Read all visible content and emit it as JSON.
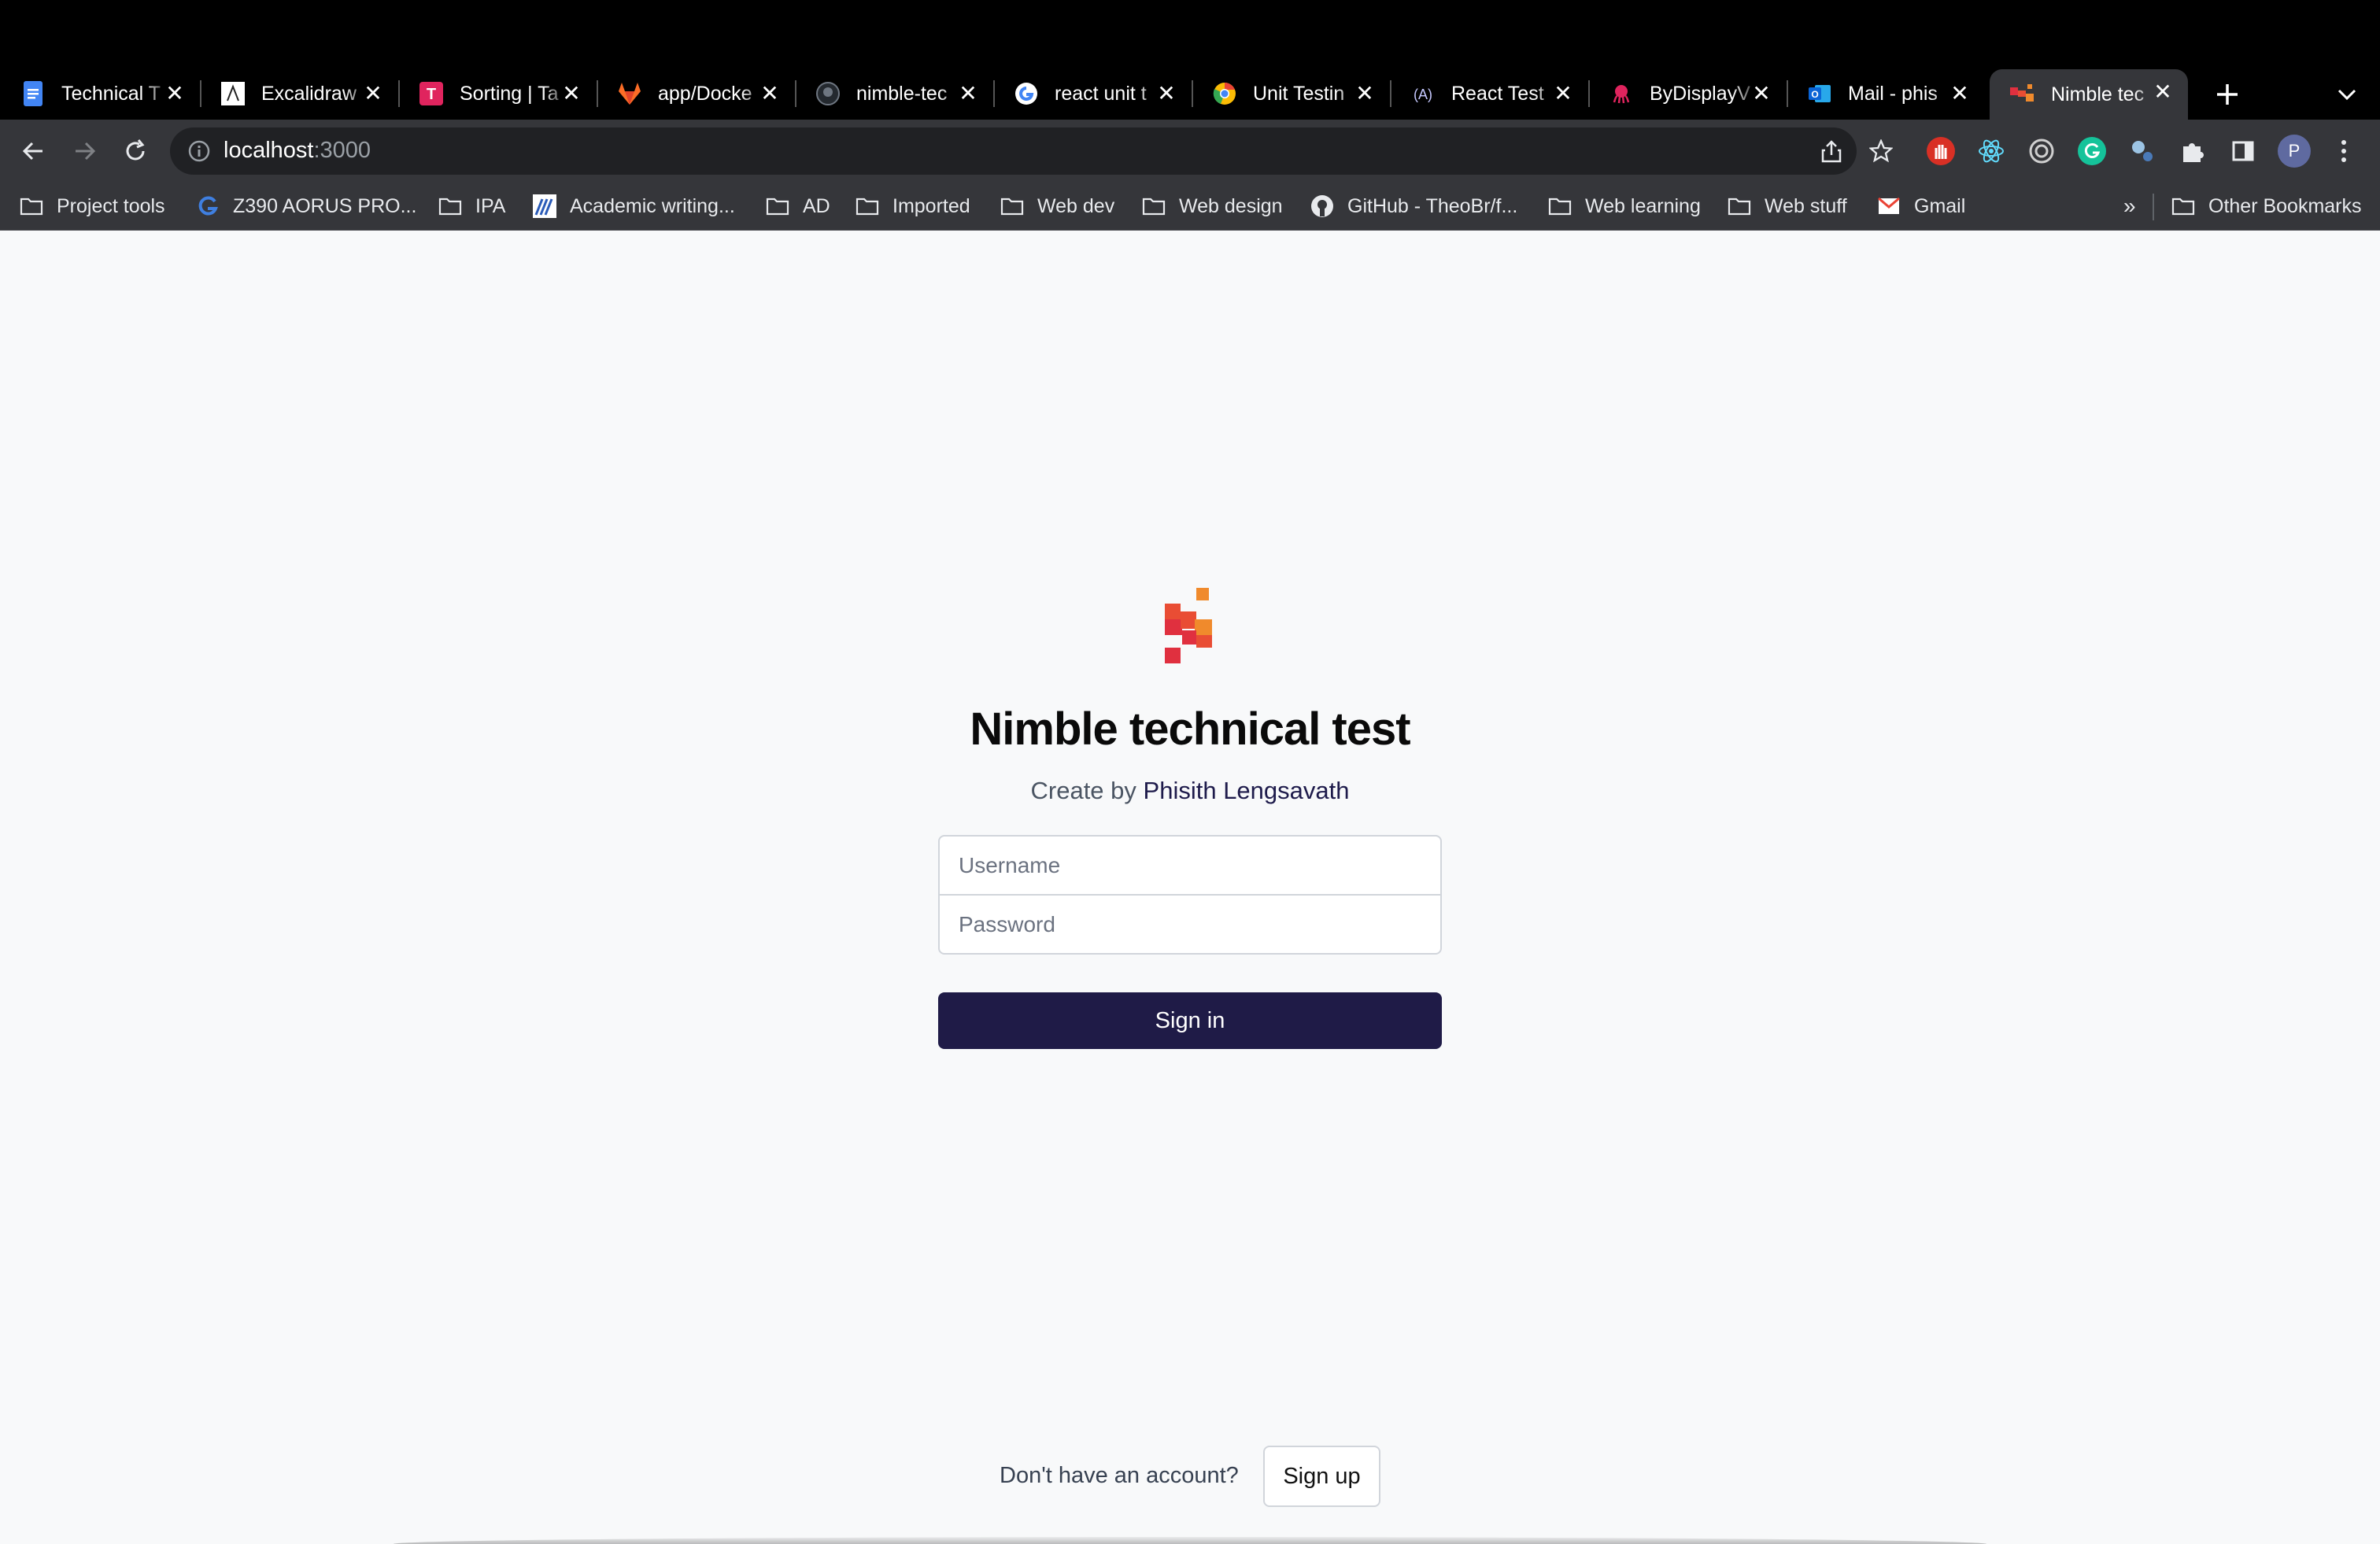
{
  "browser": {
    "tabs": [
      {
        "title": "Technical T",
        "favicon": "google-docs-icon",
        "color": "#4285f4"
      },
      {
        "title": "Excalidraw",
        "favicon": "excalidraw-icon",
        "color": "#ffffff"
      },
      {
        "title": "Sorting | Ta",
        "favicon": "tab-t-icon",
        "color": "#e0245e"
      },
      {
        "title": "app/Docke",
        "favicon": "gitlab-icon",
        "color": "#fc6d26"
      },
      {
        "title": "nimble-tec",
        "favicon": "github-icon",
        "color": "#6e7681"
      },
      {
        "title": "react unit t",
        "favicon": "google-icon",
        "color": "#4285f4"
      },
      {
        "title": "Unit Testin",
        "favicon": "chrome-icon",
        "color": "#fbbc05"
      },
      {
        "title": "React Test",
        "favicon": "react-testing-icon",
        "color": "#7c83fd"
      },
      {
        "title": "ByDisplayV",
        "favicon": "octopus-icon",
        "color": "#e0245e"
      },
      {
        "title": "Mail - phis",
        "favicon": "outlook-icon",
        "color": "#0a64d6"
      },
      {
        "title": "Nimble tec",
        "favicon": "nimble-icon",
        "color": "#e94d34",
        "active": true
      }
    ],
    "url": {
      "host": "localhost",
      "port": ":3000"
    },
    "bookmarks": [
      {
        "label": "Project tools",
        "icon": "folder-icon"
      },
      {
        "label": "Z390 AORUS PRO...",
        "icon": "gigabyte-icon"
      },
      {
        "label": "IPA",
        "icon": "folder-icon"
      },
      {
        "label": "Academic writing...",
        "icon": "academic-icon"
      },
      {
        "label": "AD",
        "icon": "folder-icon"
      },
      {
        "label": "Imported",
        "icon": "folder-icon"
      },
      {
        "label": "Web dev",
        "icon": "folder-icon"
      },
      {
        "label": "Web design",
        "icon": "folder-icon"
      },
      {
        "label": "GitHub - TheoBr/f...",
        "icon": "github-icon"
      },
      {
        "label": "Web learning",
        "icon": "folder-icon"
      },
      {
        "label": "Web stuff",
        "icon": "folder-icon"
      },
      {
        "label": "Gmail",
        "icon": "gmail-icon"
      }
    ],
    "overflow_label": "»",
    "other_bookmarks": "Other Bookmarks",
    "profile_initial": "P"
  },
  "page": {
    "title": "Nimble technical test",
    "subtitle_prefix": "Create by",
    "author": "Phisith Lengsavath",
    "username_placeholder": "Username",
    "password_placeholder": "Password",
    "signin_label": "Sign in",
    "no_account_text": "Don't have an account?",
    "signup_label": "Sign up"
  },
  "colors": {
    "primary_button": "#1f1b47",
    "logo_red": "#e0303f",
    "logo_orange": "#f08a2c"
  }
}
